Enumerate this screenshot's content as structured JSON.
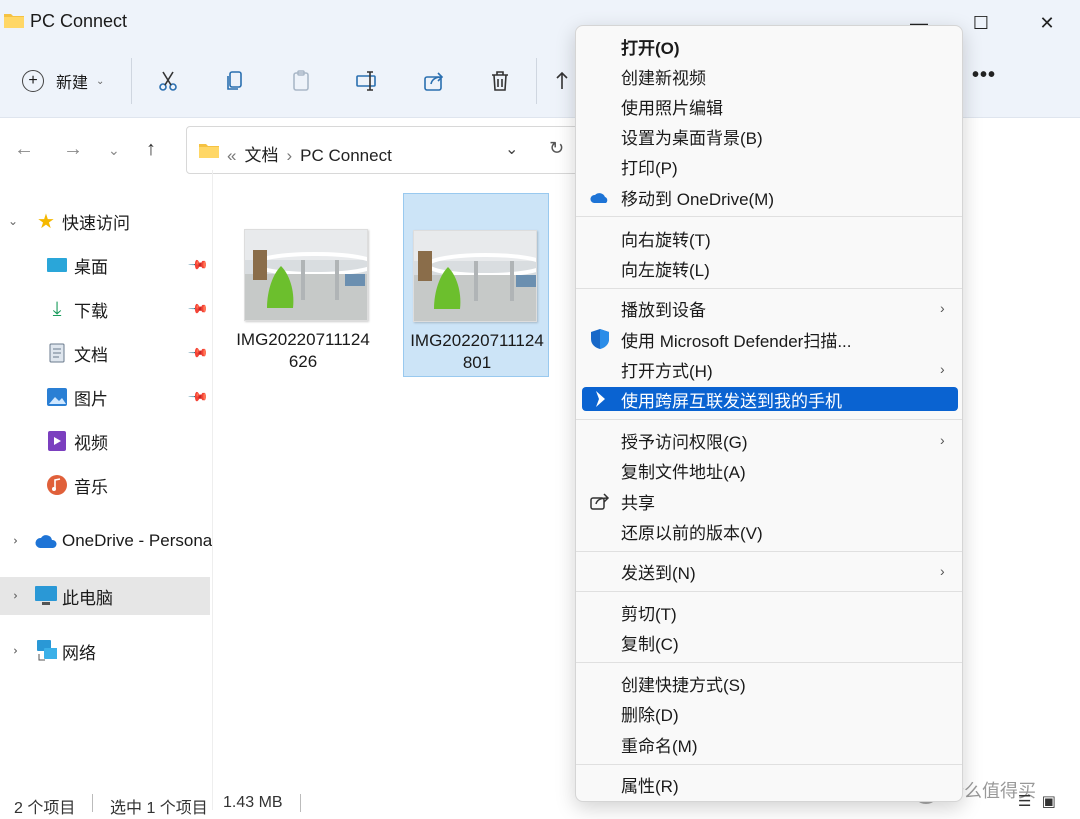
{
  "window": {
    "title": "PC Connect",
    "minimize": "—",
    "maximize": "☐",
    "close": "✕"
  },
  "toolbar": {
    "new_label": "新建",
    "more_label": "•••"
  },
  "address": {
    "prefix": "«",
    "segments": [
      "文档",
      "PC Connect"
    ],
    "separator": "›"
  },
  "sidebar": {
    "items": [
      {
        "label": "快速访问",
        "icon": "star-icon"
      },
      {
        "label": "桌面",
        "icon": "desktop-icon",
        "pinned": true
      },
      {
        "label": "下载",
        "icon": "download-icon",
        "pinned": true
      },
      {
        "label": "文档",
        "icon": "document-icon",
        "pinned": true
      },
      {
        "label": "图片",
        "icon": "pictures-icon",
        "pinned": true
      },
      {
        "label": "视频",
        "icon": "video-icon"
      },
      {
        "label": "音乐",
        "icon": "music-icon"
      },
      {
        "label": "OneDrive - Persona",
        "icon": "onedrive-icon"
      },
      {
        "label": "此电脑",
        "icon": "pc-icon"
      },
      {
        "label": "网络",
        "icon": "network-icon"
      }
    ]
  },
  "files": [
    {
      "name": "IMG20220711124626",
      "selected": false
    },
    {
      "name": "IMG20220711124801",
      "selected": true
    }
  ],
  "status": {
    "count": "2 个项目",
    "selected": "选中 1 个项目",
    "size": "1.43 MB"
  },
  "context_menu": {
    "items": [
      {
        "label": "打开(O)",
        "bold": true
      },
      {
        "label": "创建新视频"
      },
      {
        "label": "使用照片编辑"
      },
      {
        "label": "设置为桌面背景(B)"
      },
      {
        "label": "打印(P)"
      },
      {
        "label": "移动到 OneDrive(M)",
        "icon": "onedrive-icon"
      },
      {
        "label": "向右旋转(T)"
      },
      {
        "label": "向左旋转(L)"
      },
      {
        "label": "播放到设备",
        "submenu": true
      },
      {
        "label": "使用 Microsoft Defender扫描...",
        "icon": "defender-shield-icon"
      },
      {
        "label": "打开方式(H)",
        "submenu": true
      },
      {
        "label": "使用跨屏互联发送到我的手机",
        "icon": "phone-link-icon",
        "highlighted": true
      },
      {
        "label": "授予访问权限(G)",
        "submenu": true
      },
      {
        "label": "复制文件地址(A)"
      },
      {
        "label": "共享",
        "icon": "share-icon"
      },
      {
        "label": "还原以前的版本(V)"
      },
      {
        "label": "发送到(N)",
        "submenu": true
      },
      {
        "label": "剪切(T)"
      },
      {
        "label": "复制(C)"
      },
      {
        "label": "创建快捷方式(S)"
      },
      {
        "label": "删除(D)"
      },
      {
        "label": "重命名(M)"
      },
      {
        "label": "属性(R)"
      }
    ],
    "submenu_arrow": "›"
  },
  "watermark": {
    "logo": "值",
    "text": "什么值得买"
  },
  "colors": {
    "highlight": "#0a63d1",
    "selection": "#cce4f7",
    "toolbar_bg": "#eef3fa"
  }
}
